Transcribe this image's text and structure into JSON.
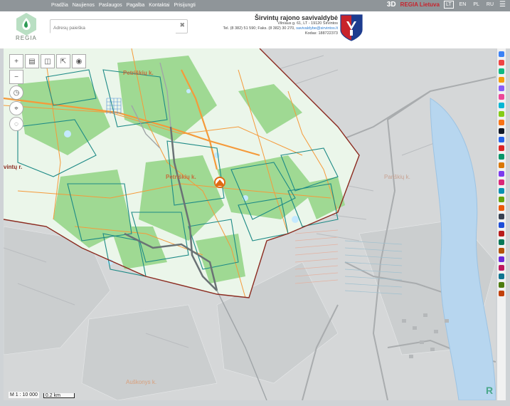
{
  "nav": {
    "items": [
      "Pradžia",
      "Naujienos",
      "Paslaugos",
      "Pagalba",
      "Kontaktai",
      "Prisijungti"
    ],
    "btn_3d": "3D",
    "regia_lt": "REGIA Lietuva",
    "langs": [
      "LT",
      "EN",
      "PL",
      "RU"
    ],
    "active_lang": "LT"
  },
  "logo": {
    "text": "REGIA"
  },
  "search": {
    "placeholder": "Adresų paieška"
  },
  "municipality": {
    "name": "Širvintų rajono savivaldybė",
    "address": "Vilniaus g. 61, LT - 19120 Širvintos",
    "contacts": "Tel. (8 382) 51 590; Faks. (8 382) 30 270,",
    "email": "savivaldybe@sirvintos.lt",
    "code": "Kodas: 188722373"
  },
  "map": {
    "labels": {
      "petr1": "Petriškių k.",
      "petr2": "Petriškių k.",
      "sirv": "vintų r.",
      "auk": "Auškonys k.",
      "park": "Pariškių k."
    },
    "scale_ratio": "M 1 : 10 000",
    "scale_bar": "0.2 km"
  },
  "colors": {
    "accent": "#c8232c",
    "land_green": "#9fd993",
    "boundary": "#8b2a1f",
    "parcel": "#1d8a86",
    "road": "#f59a3a",
    "water": "#b7d6ef"
  },
  "icons": {
    "zoom_in": "plus-icon",
    "zoom_out": "minus-icon",
    "layers": "layers-icon",
    "measure": "ruler-icon",
    "share": "share-icon",
    "locate": "target-icon",
    "history": "clock-icon",
    "crosshair": "crosshair-icon",
    "draw": "lasso-icon",
    "home_marker": "home-marker-icon"
  }
}
